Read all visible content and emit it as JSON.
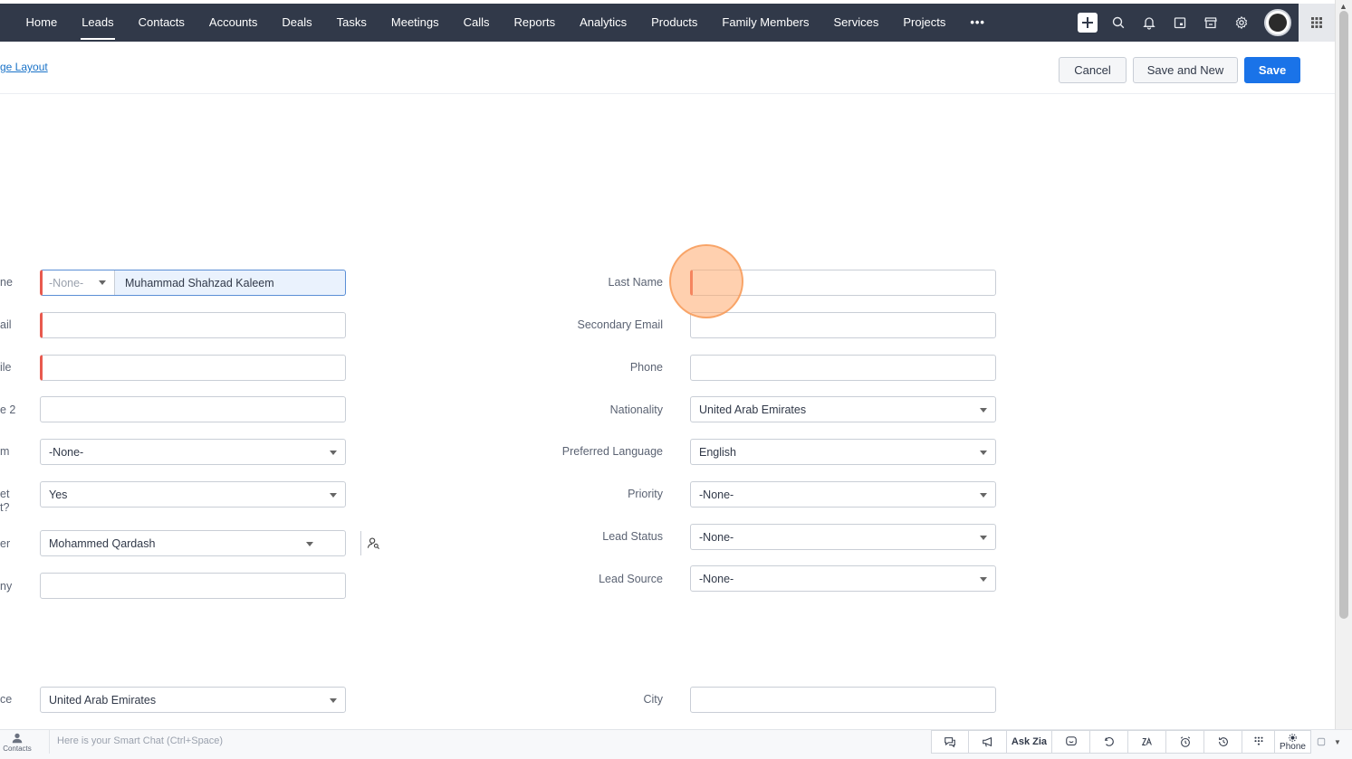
{
  "nav": {
    "tabs": [
      "Home",
      "Leads",
      "Contacts",
      "Accounts",
      "Deals",
      "Tasks",
      "Meetings",
      "Calls",
      "Reports",
      "Analytics",
      "Products",
      "Family Members",
      "Services",
      "Projects"
    ],
    "more": "•••",
    "active": "Leads",
    "icons": [
      "plus-icon",
      "search-icon",
      "bell-icon",
      "calendar-icon",
      "store-icon",
      "gear-icon",
      "avatar",
      "apps-grid-icon"
    ]
  },
  "actionbar": {
    "layout_link": "ge Layout",
    "cancel": "Cancel",
    "save_and_new": "Save and New",
    "save": "Save"
  },
  "form": {
    "left": [
      {
        "label": "ne",
        "salutation": "-None-",
        "value": "Muhammad Shahzad Kaleem"
      },
      {
        "label": "ail",
        "value": ""
      },
      {
        "label": "ile",
        "value": ""
      },
      {
        "label": "e 2",
        "value": ""
      },
      {
        "label": "m",
        "value": "-None-"
      },
      {
        "label": "et\nt?",
        "value": "Yes"
      },
      {
        "label": "er",
        "value": "Mohammed Qardash"
      },
      {
        "label": "ny",
        "value": ""
      },
      {
        "label": "ce",
        "value": "United Arab Emirates"
      }
    ],
    "right": [
      {
        "label": "Last Name",
        "value": ""
      },
      {
        "label": "Secondary Email",
        "value": ""
      },
      {
        "label": "Phone",
        "value": ""
      },
      {
        "label": "Nationality",
        "value": "United Arab Emirates"
      },
      {
        "label": "Preferred Language",
        "value": "English"
      },
      {
        "label": "Priority",
        "value": "-None-"
      },
      {
        "label": "Lead Status",
        "value": "-None-"
      },
      {
        "label": "Lead Source",
        "value": "-None-"
      },
      {
        "label": "City",
        "value": ""
      }
    ]
  },
  "bottombar": {
    "contacts": "Contacts",
    "smartchat": "Here is your Smart Chat (Ctrl+Space)",
    "ask_zia": "Ask Zia",
    "phone": "Phone"
  },
  "colors": {
    "nav_bg": "#313949",
    "primary": "#1a73e8",
    "mandatory": "#e85a4f",
    "click_highlight": "#ffaa6e"
  }
}
